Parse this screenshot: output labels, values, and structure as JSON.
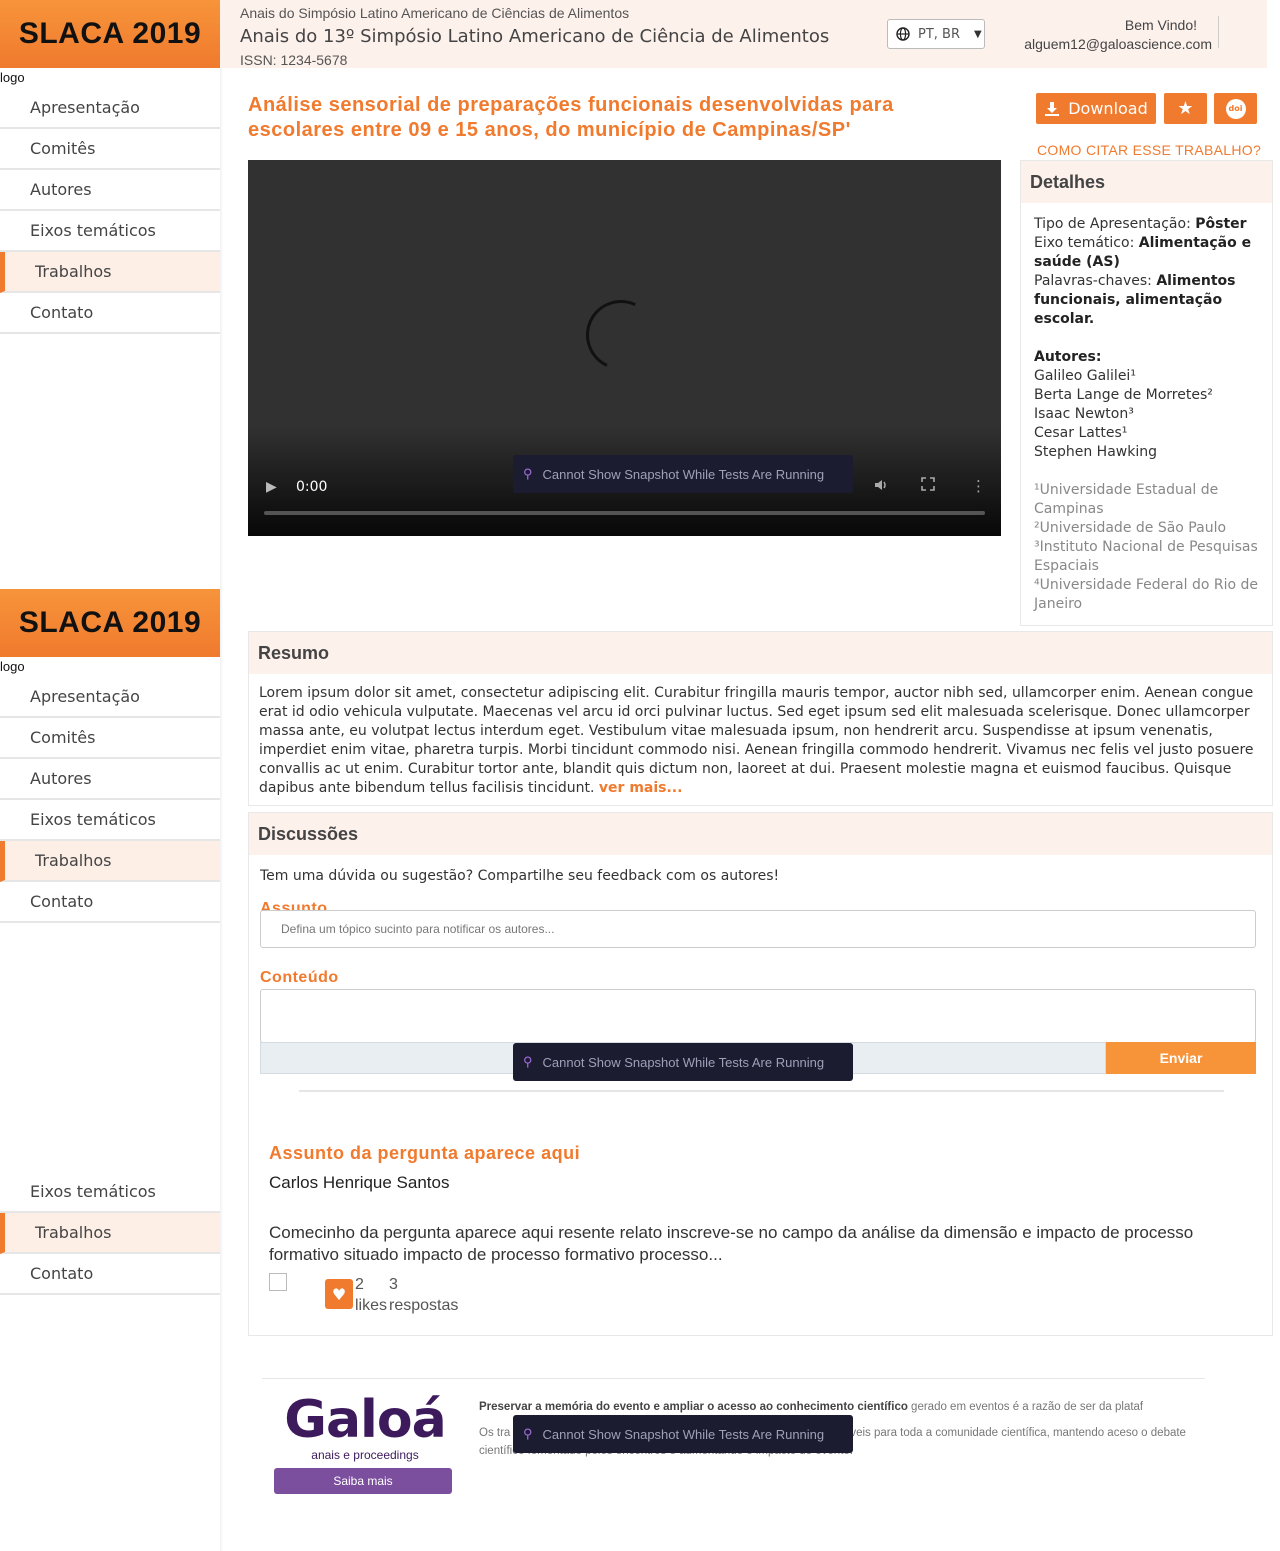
{
  "sidebar": {
    "brand": "SLACA 2019",
    "logo_alt": "logo",
    "items": [
      {
        "label": "Apresentação"
      },
      {
        "label": "Comitês"
      },
      {
        "label": "Autores"
      },
      {
        "label": "Eixos temáticos"
      },
      {
        "label": "Trabalhos"
      },
      {
        "label": "Contato"
      }
    ]
  },
  "header": {
    "subtitle": "Anais do Simpósio Latino Americano de Ciências de Alimentos",
    "title": "Anais do 13º Simpósio Latino Americano de Ciência de Alimentos",
    "issn": "ISSN: 1234-5678",
    "language": "PT, BR",
    "welcome": "Bem Vindo!",
    "email": "alguem12@galoascience.com"
  },
  "paper": {
    "title": "Análise sensorial de preparações funcionais desenvolvidas para escolares entre 09 e 15 anos, do município de Campinas/SP'",
    "download_label": "Download",
    "doi_label": "doi",
    "cite_label": "COMO CITAR ESSE TRABALHO?"
  },
  "video": {
    "time": "0:00",
    "progress": 0
  },
  "tooltip": {
    "text": "Cannot Show Snapshot While Tests Are Running"
  },
  "details": {
    "heading": "Detalhes",
    "tipo_label": "Tipo de Apresentação: ",
    "tipo_value": "Pôster",
    "eixo_label": "Eixo temático: ",
    "eixo_value": "Alimentação e saúde (AS)",
    "palavras_label": "Palavras-chaves: ",
    "palavras_value": "Alimentos funcionais, alimentação escolar.",
    "autores_label": "Autores:",
    "autores": [
      "Galileo Galilei¹",
      "Berta Lange de Morretes²",
      "Isaac Newton³",
      "Cesar Lattes¹",
      "Stephen Hawking"
    ],
    "afiliacoes": [
      "¹Universidade Estadual de Campinas",
      "²Universidade de São Paulo",
      "³Instituto Nacional de Pesquisas Espaciais",
      "⁴Universidade Federal do Rio de Janeiro"
    ]
  },
  "resumo": {
    "heading": "Resumo",
    "text": "Lorem ipsum dolor sit amet, consectetur adipiscing elit. Curabitur fringilla mauris tempor, auctor nibh sed, ullamcorper enim. Aenean congue erat id odio vehicula vulputate. Maecenas vel arcu id orci pulvinar luctus. Sed eget ipsum sed elit malesuada scelerisque. Donec ullamcorper massa ante, eu volutpat lectus interdum eget. Vestibulum vitae malesuada ipsum, non hendrerit arcu. Suspendisse at ipsum venenatis, imperdiet enim vitae, pharetra turpis. Morbi tincidunt commodo nisi. Aenean fringilla commodo hendrerit. Vivamus nec felis vel justo posuere convallis ac ut enim. Curabitur tortor ante, blandit quis dictum non, laoreet at dui. Praesent molestie magna et euismod faucibus. Quisque dapibus ante bibendum tellus facilisis tincidunt.",
    "ver_mais": "ver mais..."
  },
  "discussoes": {
    "heading": "Discussões",
    "intro": "Tem uma dúvida ou sugestão? Compartilhe seu feedback com os autores!",
    "assunto_label": "Assunto",
    "assunto_placeholder": "Defina um tópico sucinto para notificar os autores...",
    "conteudo_label": "Conteúdo",
    "enviar_label": "Enviar"
  },
  "question": {
    "title": "Assunto da pergunta aparece aqui",
    "author": "Carlos Henrique Santos",
    "body": "Comecinho da pergunta aparece aqui resente relato inscreve-se no campo da análise da dimensão e impacto de processo formativo situado impacto de processo formativo processo...",
    "likes_count": "2",
    "likes_label": "likes",
    "replies_count": "3",
    "replies_label": "respostas"
  },
  "footer": {
    "logo": "Galoá",
    "logo_sub": "anais e proceedings",
    "saiba_mais": "Saiba mais",
    "text1_bold": "Preservar a memória do evento e ampliar o acesso ao conhecimento científico",
    "text1_rest": " gerado em eventos é a razão de ser da plataf",
    "text2_start": "Os tra",
    "text2_end": "veis para toda a comunidade científica, mantendo aceso o debate científico fomentado pelos encontros e aumentando o impacto do evento."
  },
  "colors": {
    "accent": "#f07a2e",
    "header_bg": "#fdf1ec",
    "galoa_purple": "#3d1a5c"
  }
}
